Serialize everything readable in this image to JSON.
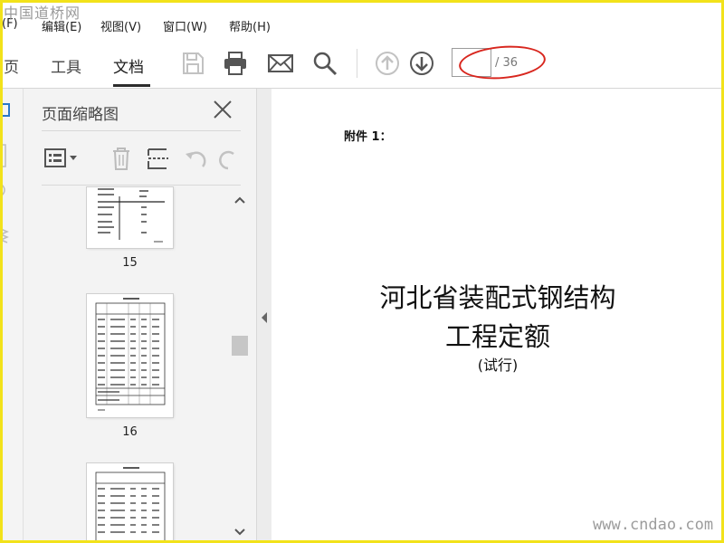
{
  "watermark": {
    "top": "中国道桥网",
    "bottom": "www.cndao.com"
  },
  "menu": [
    {
      "key": "file",
      "label": "(F)"
    },
    {
      "key": "edit",
      "label": "编辑(E)"
    },
    {
      "key": "view",
      "label": "视图(V)"
    },
    {
      "key": "window",
      "label": "窗口(W)"
    },
    {
      "key": "help",
      "label": "帮助(H)"
    }
  ],
  "tabs": {
    "home": "页",
    "tools": "工具",
    "document": "文档"
  },
  "toolbar": {
    "icons": [
      "save-icon",
      "print-icon",
      "email-icon",
      "search-icon",
      "page-up-icon",
      "page-down-icon"
    ],
    "page_current": "",
    "page_total": "/ 36",
    "annotation_color": "#d8261e"
  },
  "sidebar": {
    "title": "页面缩略图",
    "tools": [
      "thumbnail-options-icon",
      "delete-icon",
      "extract-icon",
      "undo-icon",
      "redo-icon"
    ],
    "thumbnails": [
      {
        "label": "15"
      },
      {
        "label": "16"
      },
      {
        "label": ""
      }
    ]
  },
  "document": {
    "attachment": "附件 1：",
    "title_line1": "河北省装配式钢结构",
    "title_line2": "工程定额",
    "subtitle": "(试行)"
  },
  "colors": {
    "frame": "#f2e21a",
    "accent_underline": "#2c2c2c"
  }
}
